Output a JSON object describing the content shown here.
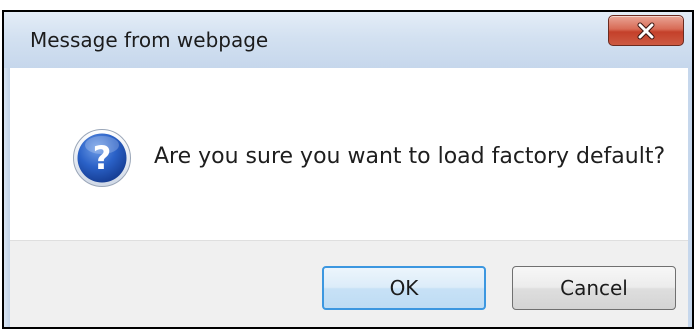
{
  "dialog": {
    "title": "Message from webpage",
    "message": "Are you sure you want to load factory default?",
    "icon": "question-icon",
    "buttons": {
      "ok_label": "OK",
      "cancel_label": "Cancel"
    }
  },
  "colors": {
    "titlebar_top": "#e4edf7",
    "titlebar_bottom": "#c6d7ec",
    "close_button": "#c4402a",
    "ok_focus_border": "#3c97e0",
    "button_area": "#f0f0f0",
    "icon_blue": "#1f56b5"
  }
}
